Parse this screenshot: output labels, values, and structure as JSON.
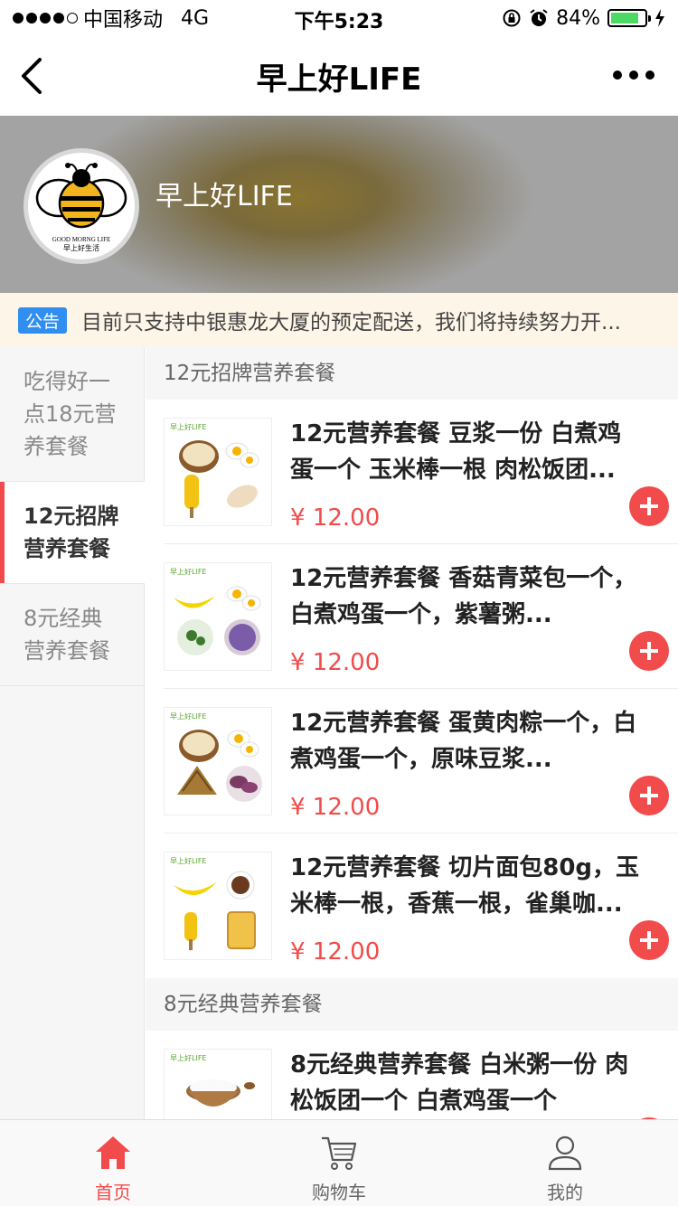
{
  "status_bar": {
    "carrier": "中国移动",
    "network": "4G",
    "time": "下午5:23",
    "battery": "84%",
    "battery_level": 0.84
  },
  "nav": {
    "title": "早上好LIFE",
    "back_icon": "chevron-left-icon",
    "more_icon": "more-dots-icon"
  },
  "shop": {
    "name": "早上好LIFE",
    "logo_text_en": "GOOD MORNG LIFE",
    "logo_text_cn": "早上好生活"
  },
  "notice": {
    "tag": "公告",
    "text": "目前只支持中银惠龙大厦的预定配送，我们将持续努力开..."
  },
  "sidebar": {
    "items": [
      {
        "label": "吃得好一点18元营养套餐",
        "active": false
      },
      {
        "label": "12元招牌营养套餐",
        "active": true
      },
      {
        "label": "8元经典营养套餐",
        "active": false
      }
    ]
  },
  "sections": [
    {
      "title": "12元招牌营养套餐",
      "products": [
        {
          "name": "12元营养套餐 豆浆一份 白煮鸡蛋一个 玉米棒一根 肉松饭团...",
          "price": "¥ 12.00",
          "brand": "早上好LIFE"
        },
        {
          "name": "12元营养套餐 香菇青菜包一个，白煮鸡蛋一个，紫薯粥...",
          "price": "¥ 12.00",
          "brand": "早上好LIFE"
        },
        {
          "name": "12元营养套餐 蛋黄肉粽一个，白煮鸡蛋一个，原味豆浆...",
          "price": "¥ 12.00",
          "brand": "早上好LIFE"
        },
        {
          "name": "12元营养套餐 切片面包80g，玉米棒一根，香蕉一根，雀巢咖...",
          "price": "¥ 12.00",
          "brand": "早上好LIFE"
        }
      ]
    },
    {
      "title": "8元经典营养套餐",
      "products": [
        {
          "name": "8元经典营养套餐 白米粥一份 肉松饭团一个 白煮鸡蛋一个",
          "price": "",
          "brand": "早上好LIFE"
        }
      ]
    }
  ],
  "tab_bar": {
    "tabs": [
      {
        "label": "首页",
        "icon": "home-icon",
        "active": true
      },
      {
        "label": "购物车",
        "icon": "cart-icon",
        "active": false
      },
      {
        "label": "我的",
        "icon": "user-icon",
        "active": false
      }
    ]
  },
  "colors": {
    "accent": "#f24b4b",
    "notice_tag": "#2f8ef0",
    "notice_bg": "#fdf6e8",
    "battery": "#4cd964"
  }
}
